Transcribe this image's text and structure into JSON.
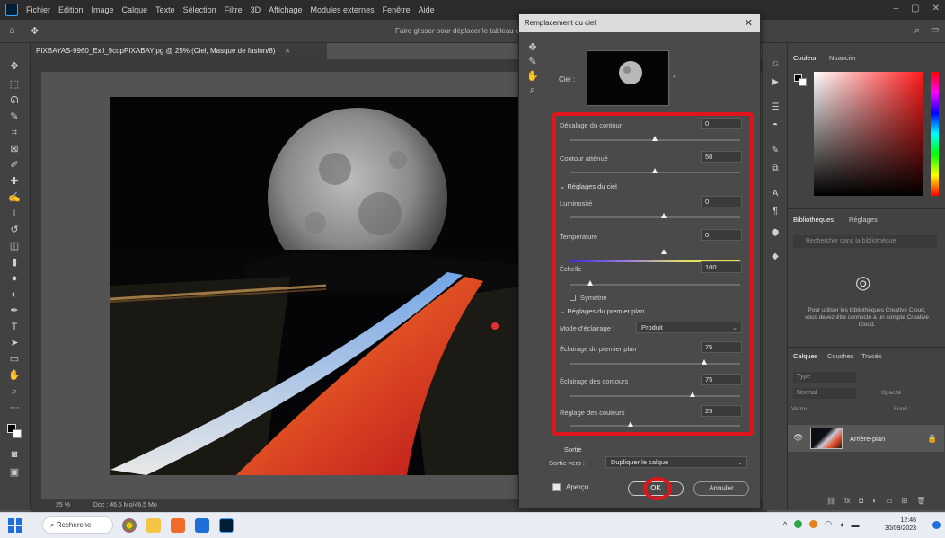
{
  "menubar": {
    "items": [
      "Fichier",
      "Edition",
      "Image",
      "Calque",
      "Texte",
      "Sélection",
      "Filtre",
      "3D",
      "Affichage",
      "Modules externes",
      "Fenêtre",
      "Aide"
    ],
    "window_controls": [
      "–",
      "▢",
      "✕"
    ]
  },
  "optionsbar": {
    "hint": "Faire glisser pour déplacer le tableau de…"
  },
  "document": {
    "tab_title": "PIXBAYAS-9960_Exil_9copPIXABAYjpg @ 25% (Ciel, Masque de fusion/8)",
    "zoom_status": "25 %",
    "dimensions_status": "Doc : 46,5 Mo/46,5 Mo"
  },
  "dialog": {
    "title": "Remplacement du ciel",
    "close_glyph": "✕",
    "sky_label": "Ciel :",
    "sections": {
      "sky_adjustments": "Réglages du ciel",
      "foreground_adjustments": "Réglages du premier plan",
      "output": "Sortie"
    },
    "fields": {
      "shift_edge": {
        "label": "Décalage du contour",
        "value": "0",
        "slider": 0.5
      },
      "fade_edge": {
        "label": "Contour atténué",
        "value": "50",
        "slider": 0.5
      },
      "brightness": {
        "label": "Luminosité",
        "value": "0",
        "slider": 0.55
      },
      "temperature": {
        "label": "Température",
        "value": "0",
        "slider": 0.55
      },
      "scale": {
        "label": "Échelle",
        "value": "100",
        "slider": 0.12
      },
      "flip": {
        "label": "Symétrie"
      },
      "lighting_mode": {
        "label": "Mode d'éclairage :",
        "value": "Produit"
      },
      "foreground_lighting": {
        "label": "Éclairage du premier plan",
        "value": "75",
        "slider": 0.79
      },
      "edge_lighting": {
        "label": "Éclairage des contours",
        "value": "75",
        "slider": 0.72
      },
      "color_adjustment": {
        "label": "Réglage des couleurs",
        "value": "25",
        "slider": 0.36
      },
      "output_to": {
        "label": "Sortie vers :",
        "value": "Dupliquer le calque"
      }
    },
    "preview_label": "Aperçu",
    "ok_label": "OK",
    "cancel_label": "Annuler"
  },
  "right_panel": {
    "tabs_top": [
      "Couleur",
      "Nuancier"
    ],
    "tabs_mid": [
      "Bibliothèques",
      "Réglages"
    ],
    "library_search_placeholder": "Rechercher dans la bibliothèque",
    "library_message": "Pour utiliser les bibliothèques Creative Cloud, vous devez être connecté à un compte Creative Cloud.",
    "tabs_bottom": [
      "Calques",
      "Couches",
      "Tracés"
    ],
    "layer_search_placeholder": "Type",
    "blend_mode": "Normal",
    "opacity_label": "Opacité :",
    "lock_label": "Verrou :",
    "fill_label": "Fond :",
    "layer_name": "Arrière-plan"
  },
  "taskbar": {
    "search_label": "Recherche",
    "time": "12:46",
    "date": "30/09/2023"
  },
  "colors": {
    "accent_red": "#e0141b",
    "ps_blue": "#31a8ff"
  }
}
